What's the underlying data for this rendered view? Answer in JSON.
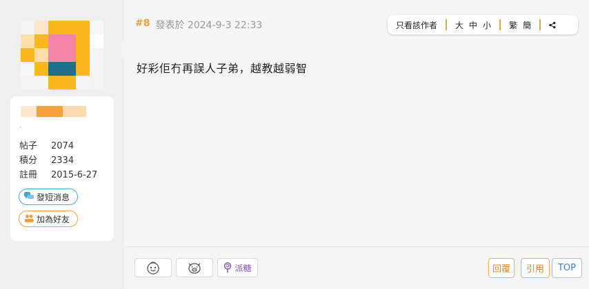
{
  "colors": {
    "accent_orange": "#e9a23b",
    "accent_blue": "#3fa6d6",
    "candy_purple": "#7b4fb0"
  },
  "user": {
    "avatar_pixels": [
      [
        "#f3f3f3",
        "#fde7c8",
        "#fbb81d",
        "#fbb81d",
        "#fbb81d",
        "#f7f7f7"
      ],
      [
        "#fde0a8",
        "#fbb81d",
        "#f584a9",
        "#f584a9",
        "#fbb81d",
        "#ffffff"
      ],
      [
        "#fbb81d",
        "#fde0a8",
        "#f584a9",
        "#f584a9",
        "#fbb81d",
        "#f3f3f3"
      ],
      [
        "#f7f7f7",
        "#fbb81d",
        "#1e6f8c",
        "#1e6f8c",
        "#fbb81d",
        "#f3f3f3"
      ],
      [
        "#f3f3f3",
        "#f3f3f3",
        "#fbb81d",
        "#fbb81d",
        "#f5f5f5",
        "#f3f3f3"
      ]
    ],
    "stats": [
      {
        "label": "帖子",
        "value": "2074"
      },
      {
        "label": "積分",
        "value": "2334"
      },
      {
        "label": "註冊",
        "value": "2015-6-27"
      }
    ],
    "pm_label": "發短消息",
    "pm_icon": "chat-bubbles-icon",
    "friend_label": "加為好友",
    "friend_icon": "users-icon"
  },
  "post": {
    "floor": "#8",
    "posted_text": "發表於 2024-9-3 22:33",
    "content": "好彩佢冇再誤人子弟，越教越弱智"
  },
  "toolbar": {
    "only_author": "只看該作者",
    "size_large": "大",
    "size_medium": "中",
    "size_small": "小",
    "trad": "繁",
    "simp": "簡",
    "share_icon": "share-icon"
  },
  "footer": {
    "emoji1_icon": "smile-face-icon",
    "emoji2_icon": "pig-face-icon",
    "candy_icon": "lollipop-icon",
    "candy_label": "派糖",
    "reply_label": "回覆",
    "quote_label": "引用",
    "top_label": "TOP"
  }
}
